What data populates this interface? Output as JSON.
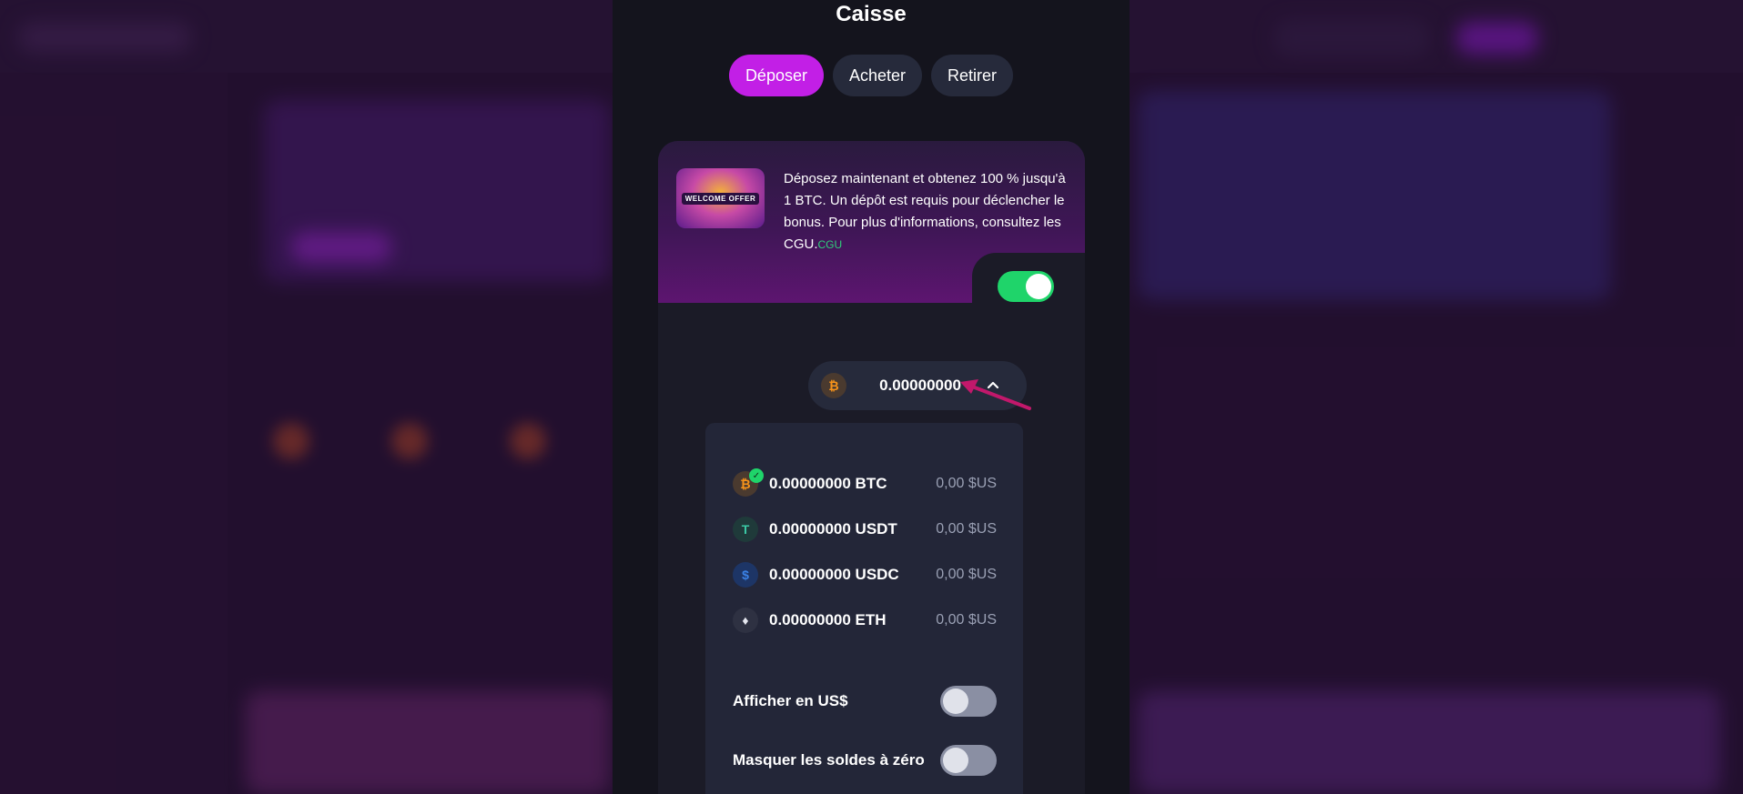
{
  "modal": {
    "title": "Caisse",
    "tabs": [
      {
        "label": "Déposer",
        "active": true
      },
      {
        "label": "Acheter",
        "active": false
      },
      {
        "label": "Retirer",
        "active": false
      }
    ]
  },
  "promo": {
    "image_label": "WELCOME OFFER",
    "text": "Déposez maintenant et obtenez 100 % jusqu'à 1 BTC. Un dépôt est requis pour déclencher le bonus. Pour plus d'informations, consultez les CGU.",
    "link": "CGU",
    "bonus_toggle_on": true
  },
  "selector": {
    "amount": "0.00000000",
    "icon": "bitcoin-icon"
  },
  "coins": [
    {
      "amount": "0.00000000 BTC",
      "usd": "0,00 $US",
      "icon": "bitcoin-icon",
      "glyph": "₿",
      "bg": "#4a3a2f",
      "fg": "#f7931a",
      "selected": true
    },
    {
      "amount": "0.00000000 USDT",
      "usd": "0,00 $US",
      "icon": "tether-icon",
      "glyph": "T",
      "bg": "#1f3a3a",
      "fg": "#3bc9a5",
      "selected": false
    },
    {
      "amount": "0.00000000 USDC",
      "usd": "0,00 $US",
      "icon": "usdc-icon",
      "glyph": "$",
      "bg": "#1d3566",
      "fg": "#3b82e6",
      "selected": false
    },
    {
      "amount": "0.00000000 ETH",
      "usd": "0,00 $US",
      "icon": "ethereum-icon",
      "glyph": "♦",
      "bg": "#2e3142",
      "fg": "#e6e8f0",
      "selected": false
    }
  ],
  "settings": {
    "show_usd": {
      "label": "Afficher en US$",
      "on": false
    },
    "hide_zero": {
      "label": "Masquer les soldes à zéro",
      "on": false
    }
  },
  "colors": {
    "accent": "#c21fe6",
    "toggle_on": "#1fd46a",
    "link": "#2fd17a",
    "arrow": "#c2186b"
  }
}
